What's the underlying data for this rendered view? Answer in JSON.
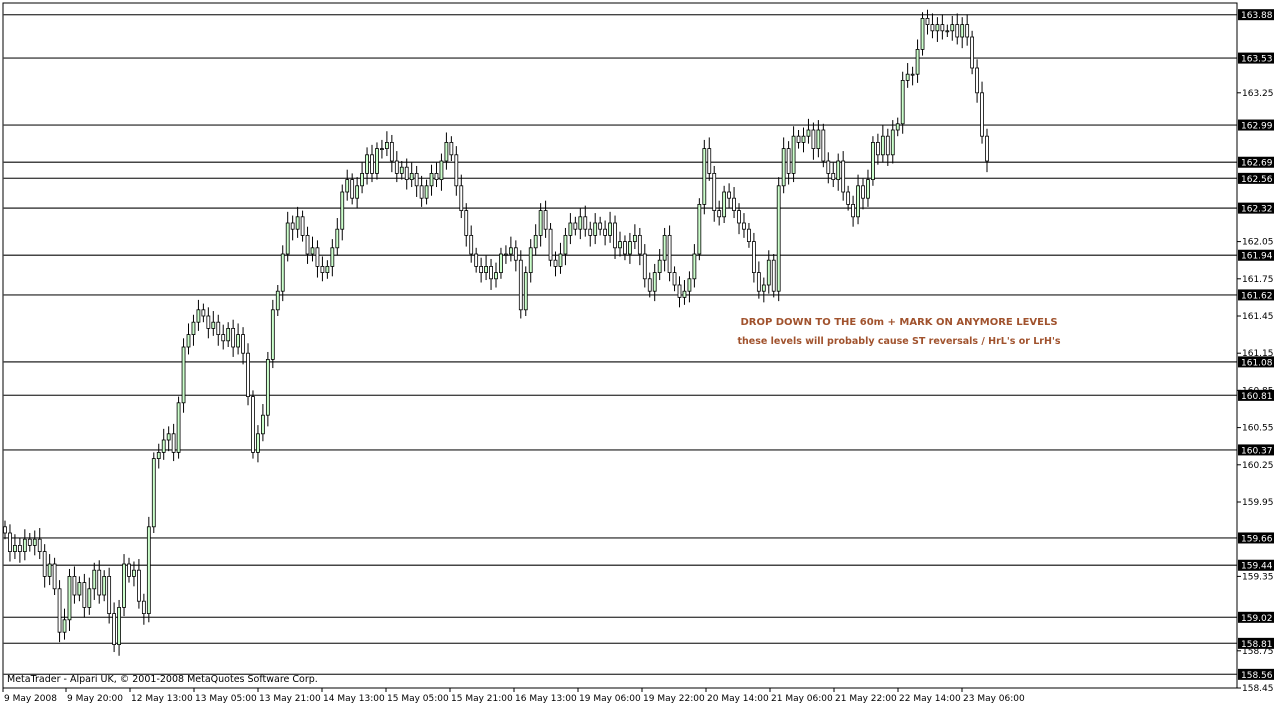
{
  "chart_data": {
    "type": "candlestick",
    "price_range": [
      158.45,
      163.95
    ],
    "y_ticks": [
      "163.25",
      "162.05",
      "161.75",
      "161.45",
      "161.15",
      "160.85",
      "160.55",
      "160.25",
      "159.95",
      "159.35",
      "158.75",
      "158.45"
    ],
    "x_labels": [
      "9 May 2008",
      "9 May 20:00",
      "12 May 13:00",
      "13 May 05:00",
      "13 May 21:00",
      "14 May 13:00",
      "15 May 05:00",
      "15 May 21:00",
      "16 May 13:00",
      "19 May 06:00",
      "19 May 22:00",
      "20 May 14:00",
      "21 May 06:00",
      "21 May 22:00",
      "22 May 14:00",
      "23 May 06:00"
    ],
    "levels": [
      "163.88",
      "163.53",
      "162.99",
      "162.69",
      "162.56",
      "162.32",
      "161.94",
      "161.62",
      "161.08",
      "160.81",
      "160.37",
      "159.66",
      "159.44",
      "159.02",
      "158.81",
      "158.56"
    ],
    "closes": [
      159.7,
      159.55,
      159.6,
      159.55,
      159.65,
      159.6,
      159.65,
      159.55,
      159.35,
      159.45,
      159.25,
      158.9,
      159.0,
      159.35,
      159.2,
      159.3,
      159.1,
      159.25,
      159.4,
      159.2,
      159.35,
      159.05,
      158.8,
      159.1,
      159.45,
      159.35,
      159.4,
      159.15,
      159.05,
      159.75,
      160.3,
      160.35,
      160.45,
      160.5,
      160.35,
      160.75,
      161.2,
      161.3,
      161.4,
      161.5,
      161.45,
      161.35,
      161.4,
      161.3,
      161.25,
      161.35,
      161.2,
      161.3,
      161.15,
      160.8,
      160.35,
      160.5,
      160.65,
      161.1,
      161.5,
      161.65,
      161.95,
      162.2,
      162.15,
      162.25,
      162.1,
      161.95,
      162.0,
      161.85,
      161.8,
      161.85,
      162.0,
      162.15,
      162.45,
      162.55,
      162.4,
      162.5,
      162.6,
      162.75,
      162.6,
      162.8,
      162.8,
      162.85,
      162.7,
      162.6,
      162.65,
      162.55,
      162.6,
      162.5,
      162.4,
      162.5,
      162.6,
      162.55,
      162.7,
      162.85,
      162.75,
      162.5,
      162.3,
      162.1,
      161.95,
      161.85,
      161.8,
      161.85,
      161.75,
      161.8,
      161.95,
      161.95,
      162.0,
      161.9,
      161.5,
      161.8,
      162.0,
      162.1,
      162.3,
      162.15,
      161.9,
      161.85,
      161.95,
      162.1,
      162.2,
      162.15,
      162.25,
      162.15,
      162.1,
      162.2,
      162.15,
      162.1,
      162.2,
      162.0,
      162.05,
      161.95,
      162.05,
      162.1,
      161.95,
      161.75,
      161.65,
      161.8,
      161.9,
      162.1,
      161.8,
      161.7,
      161.6,
      161.65,
      161.75,
      161.95,
      162.35,
      162.8,
      162.6,
      162.3,
      162.25,
      162.45,
      162.4,
      162.3,
      162.2,
      162.15,
      162.05,
      161.8,
      161.65,
      161.7,
      161.9,
      161.65,
      162.5,
      162.8,
      162.6,
      162.9,
      162.85,
      162.9,
      162.95,
      162.8,
      162.95,
      162.7,
      162.6,
      162.55,
      162.7,
      162.45,
      162.35,
      162.25,
      162.5,
      162.4,
      162.55,
      162.85,
      162.75,
      162.9,
      162.75,
      162.95,
      163.0,
      163.35,
      163.4,
      163.4,
      163.6,
      163.85,
      163.8,
      163.75,
      163.8,
      163.75,
      163.75,
      163.8,
      163.7,
      163.8,
      163.7,
      163.45,
      163.25,
      162.9,
      162.7
    ],
    "series": [
      {
        "name": "",
        "color": "#000000"
      }
    ]
  },
  "annotations": {
    "line1": "DROP DOWN TO THE 60m + MARK ON ANYMORE LEVELS",
    "line2": "these levels will probably cause ST reversals / HrL's or LrH's"
  },
  "footer": {
    "copyright": "MetaTrader - Alpari UK, © 2001-2008 MetaQuotes Software Corp."
  },
  "colors": {
    "bull_body": "#ccffcc",
    "bear_body": "#ffffff",
    "annotation": "#a0522d",
    "level_label_bg": "#000000"
  }
}
